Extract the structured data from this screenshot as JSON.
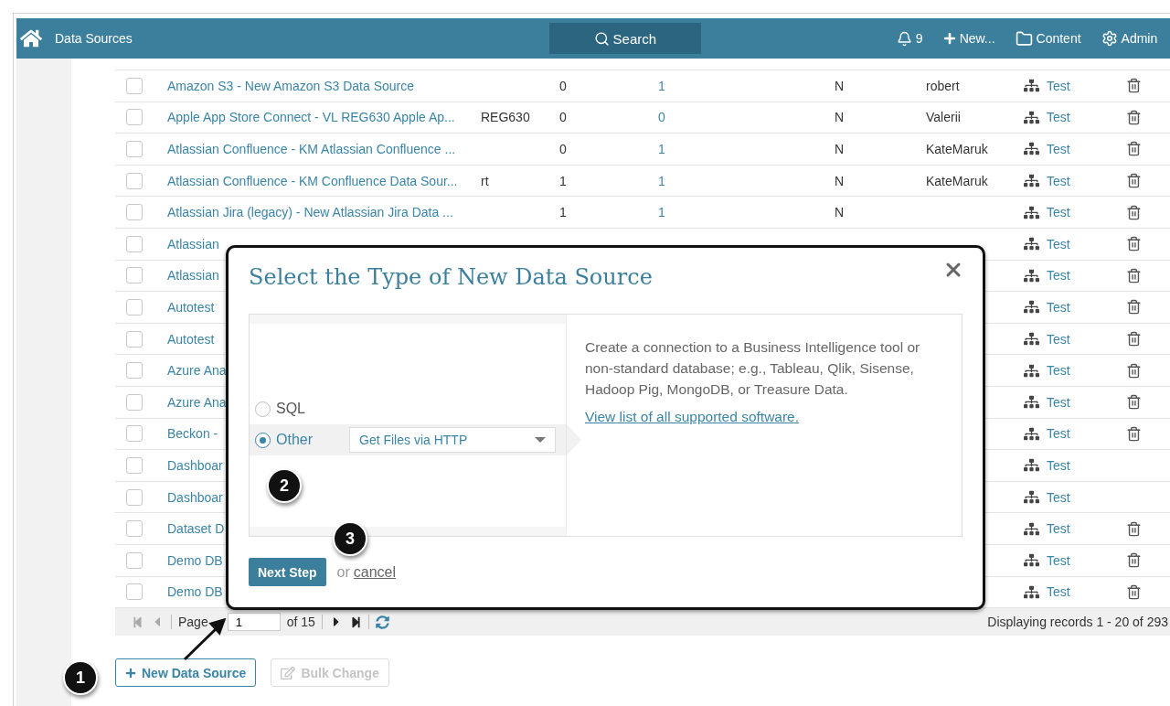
{
  "header": {
    "title": "Data Sources",
    "search_label": "Search",
    "notifications": "9",
    "new_label": "New...",
    "content_label": "Content",
    "admin_label": "Admin"
  },
  "table": {
    "rows": [
      {
        "checked": false,
        "name": "Amazon S3 - New Amazon S3 Data Source",
        "code": "",
        "col_3": "0",
        "col_4": "1",
        "col_5": "N",
        "owner": "robert",
        "test": "Test",
        "deletable": true
      },
      {
        "checked": false,
        "name": "Apple App Store Connect - VL REG630 Apple Ap...",
        "code": "REG630",
        "col_3": "0",
        "col_4": "0",
        "col_5": "N",
        "owner": "Valerii",
        "test": "Test",
        "deletable": true
      },
      {
        "checked": false,
        "name": "Atlassian Confluence - KM Atlassian Confluence ...",
        "code": "",
        "col_3": "0",
        "col_4": "1",
        "col_5": "N",
        "owner": "KateMaruk",
        "test": "Test",
        "deletable": true
      },
      {
        "checked": false,
        "name": "Atlassian Confluence - KM Confluence Data Sour...",
        "code": "rt",
        "col_3": "1",
        "col_4": "1",
        "col_5": "N",
        "owner": "KateMaruk",
        "test": "Test",
        "deletable": true
      },
      {
        "checked": false,
        "name": "Atlassian Jira (legacy) - New Atlassian Jira Data ...",
        "code": "",
        "col_3": "1",
        "col_4": "1",
        "col_5": "N",
        "owner": "",
        "test": "Test",
        "deletable": true
      },
      {
        "checked": false,
        "name": "Atlassian",
        "test": "Test",
        "deletable": true
      },
      {
        "checked": false,
        "name": "Atlassian",
        "test": "Test",
        "deletable": true
      },
      {
        "checked": false,
        "name": "Autotest",
        "test": "Test",
        "deletable": true
      },
      {
        "checked": false,
        "name": "Autotest",
        "test": "Test",
        "deletable": true
      },
      {
        "checked": false,
        "name": "Azure Ana",
        "test": "Test",
        "deletable": true
      },
      {
        "checked": false,
        "name": "Azure Ana",
        "test": "Test",
        "deletable": true
      },
      {
        "checked": false,
        "name": "Beckon -",
        "test": "Test",
        "deletable": true
      },
      {
        "checked": false,
        "name": "Dashboar",
        "test": "Test",
        "deletable": false
      },
      {
        "checked": false,
        "name": "Dashboar",
        "test": "Test",
        "deletable": false
      },
      {
        "checked": false,
        "name": "Dataset D",
        "test": "Test",
        "deletable": true
      },
      {
        "checked": false,
        "name": "Demo DB",
        "test": "Test",
        "deletable": true
      },
      {
        "checked": false,
        "name": "Demo DB",
        "test": "Test",
        "deletable": true
      }
    ]
  },
  "pager": {
    "page_label": "Page",
    "page_value": "1",
    "of_label": "of 15",
    "records": "Displaying records 1 - 20 of 293"
  },
  "actions": [
    {
      "label": "New Data Source",
      "disabled": false
    },
    {
      "label": "Bulk Change",
      "disabled": true
    }
  ],
  "dialog": {
    "title": "Select the Type of New Data Source",
    "options": [
      {
        "label": "SQL",
        "selected": false
      },
      {
        "label": "Other",
        "selected": true,
        "select_value": "Get Files via HTTP"
      }
    ],
    "description": "Create a connection to a Business Intelligence tool or non-standard database; e.g., Tableau, Qlik, Sisense, Hadoop Pig, MongoDB, or Treasure Data.",
    "link": "View list of all supported software.",
    "next_label": "Next Step",
    "or_label": "or",
    "cancel_label": "cancel"
  },
  "annotations": [
    {
      "number": "1"
    },
    {
      "number": "2"
    },
    {
      "number": "3"
    }
  ]
}
